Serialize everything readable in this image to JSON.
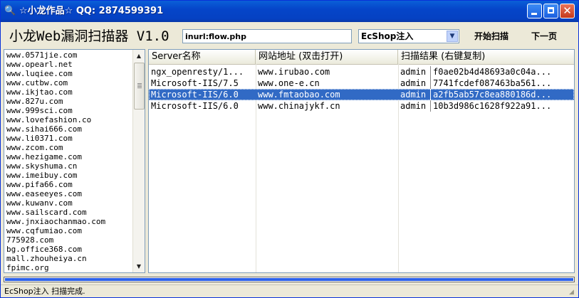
{
  "window": {
    "title": "☆小龙作品☆ QQ: 2874599391",
    "app_icon": "magnifier-icon",
    "controls": {
      "minimize": "minimize-icon",
      "maximize": "maximize-icon",
      "close_glyph": "✕"
    }
  },
  "toolbar": {
    "heading": "小龙Web漏洞扫描器 V1.0",
    "search_value": "inurl:flow.php",
    "engine_selected": "EcShop注入",
    "start_label": "开始扫描",
    "next_label": "下一页"
  },
  "site_list": [
    "www.0571jie.com",
    "www.opearl.net",
    "www.luqiee.com",
    "www.cutbw.com",
    "www.ikjtao.com",
    "www.827u.com",
    "www.999sci.com",
    "www.lovefashion.co",
    "www.sihai666.com",
    "www.li0371.com",
    "www.zcom.com",
    "www.hezigame.com",
    "www.skyshuma.cn",
    "www.imeibuy.com",
    "www.pifa66.com",
    "www.easeeyes.com",
    "www.kuwanv.com",
    "www.sailscard.com",
    "www.jnxiaochanmao.com",
    "www.cqfumiao.com",
    "775928.com",
    "bg.office368.com",
    "mall.zhouheiya.cn",
    "fpimc.org"
  ],
  "results": {
    "columns": [
      "Server名称",
      "网站地址 (双击打开)",
      "扫描结果 (右键复制)"
    ],
    "rows": [
      {
        "server": "ngx_openresty/1...",
        "url": "www.irubao.com",
        "user": "admin",
        "hash": "f0ae02b4d48693a0c04a...",
        "selected": false
      },
      {
        "server": "Microsoft-IIS/7.5",
        "url": "www.one-e.cn",
        "user": "admin",
        "hash": "7741fcdef087463ba561...",
        "selected": false
      },
      {
        "server": "Microsoft-IIS/6.0",
        "url": "www.fmtaobao.com",
        "user": "admin",
        "hash": "a2fb5ab57c8ea880186d...",
        "selected": true
      },
      {
        "server": "Microsoft-IIS/6.0",
        "url": "www.chinajykf.cn",
        "user": "admin",
        "hash": "10b3d986c1628f922a91...",
        "selected": false
      }
    ]
  },
  "progress": {
    "fraction": 1.0
  },
  "status": {
    "text": "EcShop注入 扫描完成."
  },
  "colors": {
    "titlebar": "#0545c9",
    "selection": "#316ac5",
    "progress": "#2b61ea"
  }
}
